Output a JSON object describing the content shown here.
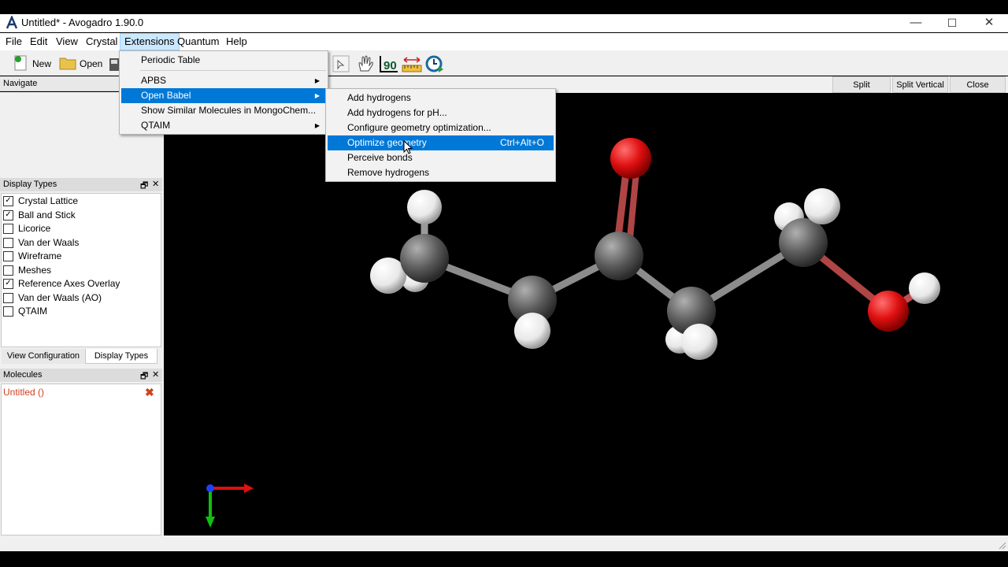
{
  "window": {
    "title": "Untitled* - Avogadro 1.90.0",
    "minimize": "—",
    "maximize": "☐",
    "close": "✕"
  },
  "menubar": [
    "File",
    "Edit",
    "View",
    "Crystal",
    "Extensions",
    "Quantum",
    "Help"
  ],
  "toolbar": {
    "new_label": "New",
    "open_label": "Open",
    "rotation_label": "90"
  },
  "navigate_label": "Navigate",
  "view_buttons": {
    "split_horizontal": "Split Horizontal",
    "split_vertical": "Split Vertical",
    "close": "Close"
  },
  "display_types": {
    "title": "Display Types",
    "items": [
      {
        "label": "Crystal Lattice",
        "checked": true,
        "mark": "✓"
      },
      {
        "label": "Ball and Stick",
        "checked": true,
        "mark": "✓"
      },
      {
        "label": "Licorice",
        "checked": false,
        "mark": ""
      },
      {
        "label": "Van der Waals",
        "checked": false,
        "mark": ""
      },
      {
        "label": "Wireframe",
        "checked": false,
        "mark": ""
      },
      {
        "label": "Meshes",
        "checked": false,
        "mark": ""
      },
      {
        "label": "Reference Axes Overlay",
        "checked": true,
        "mark": "✓"
      },
      {
        "label": "Van der Waals (AO)",
        "checked": false,
        "mark": ""
      },
      {
        "label": "QTAIM",
        "checked": false,
        "mark": ""
      }
    ]
  },
  "tabs": [
    "View Configuration",
    "Display Types"
  ],
  "molecules": {
    "title": "Molecules",
    "items": [
      {
        "label": "Untitled ()",
        "remove_icon": "✖"
      }
    ]
  },
  "dock_controls": {
    "float": "🗗",
    "close": "✕"
  },
  "extensions_menu": [
    {
      "label": "Periodic Table",
      "submenu": false
    },
    {
      "label": "APBS",
      "submenu": true
    },
    {
      "label": "Open Babel",
      "submenu": true,
      "highlighted": true
    },
    {
      "label": "Show Similar Molecules in MongoChem...",
      "submenu": false
    },
    {
      "label": "QTAIM",
      "submenu": true
    }
  ],
  "openbabel_menu": [
    {
      "label": "Add hydrogens",
      "shortcut": ""
    },
    {
      "label": "Add hydrogens for pH...",
      "shortcut": ""
    },
    {
      "label": "Configure geometry optimization...",
      "shortcut": ""
    },
    {
      "label": "Optimize geometry",
      "shortcut": "Ctrl+Alt+O",
      "highlighted": true
    },
    {
      "label": "Perceive bonds",
      "shortcut": ""
    },
    {
      "label": "Remove hydrogens",
      "shortcut": ""
    }
  ],
  "submenu_arrow": "▶",
  "colors": {
    "carbon": "#6e6e6e",
    "oxygen": "#e01010",
    "hydrogen": "#f2f2f2",
    "highlight": "#0078d7",
    "error_text": "#d04020"
  }
}
